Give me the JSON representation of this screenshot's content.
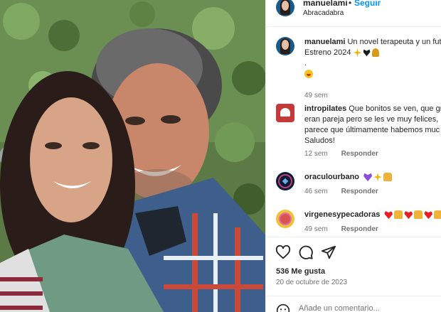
{
  "post": {
    "author": {
      "username": "manuelami",
      "separator": "•",
      "follow_label": "Seguir",
      "subtitle": "Abracadabra"
    },
    "caption": {
      "username": "manuelami",
      "line1": "Un novel terapeuta y un fut",
      "line2": "Estreno 2024",
      "line3": ".",
      "time": "49 sem"
    },
    "comments": [
      {
        "username": "intropilates",
        "lines": [
          "Que bonitos se ven, que gr",
          "eran pareja pero se les ve muy felices, lo",
          "parece que últimamente habemos muc",
          "Saludos!"
        ],
        "time": "12 sem",
        "reply_label": "Responder"
      },
      {
        "username": "oraculourbano",
        "time": "46 sem",
        "reply_label": "Responder"
      },
      {
        "username": "virgenesypecadoras",
        "time": "49 sem",
        "reply_label": "Responder"
      }
    ],
    "likes": "536 Me gusta",
    "date": "20 de octubre de 2023",
    "comment_placeholder": "Añade un comentario..."
  },
  "icons": {
    "like": "heart-outline-icon",
    "comment": "speech-bubble-icon",
    "share": "paper-plane-icon",
    "emoji": "smiley-icon"
  },
  "colors": {
    "link_blue": "#0095f6",
    "text_primary": "#262626",
    "text_secondary": "#737373",
    "divider": "#efefef"
  }
}
